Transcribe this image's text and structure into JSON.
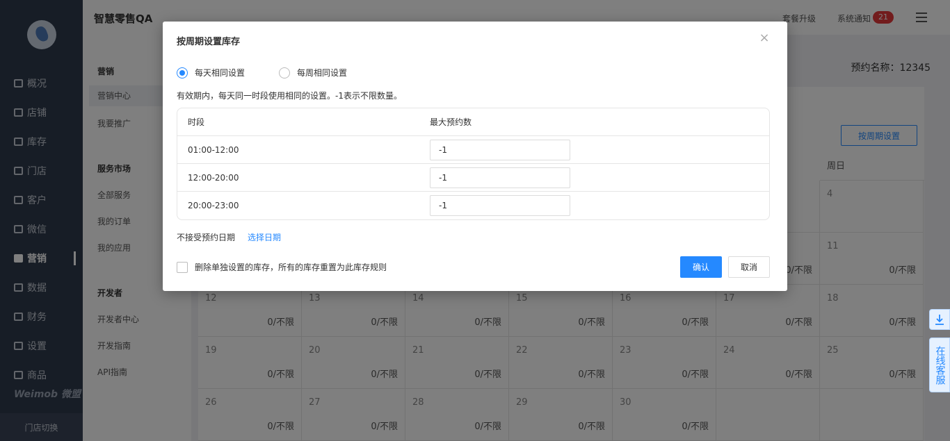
{
  "app": {
    "title": "智慧零售QA",
    "package_upgrade": "套餐升级",
    "system_notice": "系统通知",
    "notice_count": "21",
    "brand": "Weimob 微盟",
    "store_switch": "门店切换"
  },
  "sidebar": {
    "items": [
      {
        "label": "概况",
        "icon": "overview-icon"
      },
      {
        "label": "店铺",
        "icon": "shop-icon"
      },
      {
        "label": "库存",
        "icon": "inventory-icon"
      },
      {
        "label": "门店",
        "icon": "store-icon"
      },
      {
        "label": "客户",
        "icon": "customer-icon"
      },
      {
        "label": "微信",
        "icon": "wechat-icon"
      },
      {
        "label": "营销",
        "icon": "marketing-icon",
        "active": true
      },
      {
        "label": "数据",
        "icon": "data-icon"
      },
      {
        "label": "财务",
        "icon": "finance-icon"
      },
      {
        "label": "设置",
        "icon": "settings-icon"
      },
      {
        "label": "商品",
        "icon": "goods-icon"
      }
    ]
  },
  "subnav": {
    "group1": "营销",
    "marketing_center": "营销中心",
    "promote": "我要推广",
    "group2": "服务市场",
    "all_services": "全部服务",
    "my_orders": "我的订单",
    "my_apps": "我的应用",
    "group3": "开发者",
    "dev_center": "开发者中心",
    "dev_guide": "开发指南",
    "api_guide": "API指南"
  },
  "content": {
    "booking_name": "预约名称：12345",
    "set_weekly_button": "按周期设置",
    "calendar": {
      "sunday_header": "周日",
      "rows": [
        [
          {
            "day": "",
            "stock": ""
          },
          {
            "day": "",
            "stock": ""
          },
          {
            "day": "",
            "stock": ""
          },
          {
            "day": "",
            "stock": ""
          },
          {
            "day": "",
            "stock": ""
          },
          {
            "day": "",
            "stock": ""
          },
          {
            "day": "4",
            "stock": ""
          }
        ],
        [
          {
            "day": "",
            "stock": ""
          },
          {
            "day": "",
            "stock": ""
          },
          {
            "day": "",
            "stock": ""
          },
          {
            "day": "",
            "stock": ""
          },
          {
            "day": "",
            "stock": ""
          },
          {
            "day": "",
            "stock": "0/不限"
          },
          {
            "day": "11",
            "stock": "0/不限"
          }
        ],
        [
          {
            "day": "12",
            "stock": "0/不限"
          },
          {
            "day": "13",
            "stock": "0/不限"
          },
          {
            "day": "14",
            "stock": "0/不限"
          },
          {
            "day": "15",
            "stock": "0/不限"
          },
          {
            "day": "16",
            "stock": "0/不限"
          },
          {
            "day": "17",
            "stock": "0/不限"
          },
          {
            "day": "18",
            "stock": "0/不限"
          }
        ],
        [
          {
            "day": "19",
            "stock": "0/不限"
          },
          {
            "day": "20",
            "stock": "0/不限"
          },
          {
            "day": "21",
            "stock": "0/不限"
          },
          {
            "day": "22",
            "stock": "0/不限"
          },
          {
            "day": "23",
            "stock": "0/不限"
          },
          {
            "day": "24",
            "stock": "0/不限"
          },
          {
            "day": "25",
            "stock": "0/不限"
          }
        ],
        [
          {
            "day": "26",
            "stock": "0/不限"
          },
          {
            "day": "27",
            "stock": "0/不限"
          },
          {
            "day": "28",
            "stock": "0/不限"
          },
          {
            "day": "29",
            "stock": "0/不限"
          },
          {
            "day": "30",
            "stock": "0/不限"
          },
          {
            "day": "",
            "stock": ""
          },
          {
            "day": "",
            "stock": ""
          }
        ]
      ]
    }
  },
  "float": {
    "online_service": "在线客服"
  },
  "modal": {
    "title": "按周期设置库存",
    "close": "×",
    "radio_daily": "每天相同设置",
    "radio_weekly": "每周相同设置",
    "selected": "daily",
    "hint": "有效期内，每天同一时段使用相同的设置。-1表示不限数量。",
    "table": {
      "col_period": "时段",
      "col_max": "最大预约数",
      "rows": [
        {
          "period": "01:00-12:00",
          "max": "-1"
        },
        {
          "period": "12:00-20:00",
          "max": "-1"
        },
        {
          "period": "20:00-23:00",
          "max": "-1"
        }
      ]
    },
    "no_booking_label": "不接受预约日期",
    "choose_date": "选择日期",
    "delete_checkbox": "删除单独设置的库存，所有的库存重置为此库存规则",
    "confirm": "确认",
    "cancel": "取消"
  },
  "colors": {
    "accent": "#2589ff",
    "sidebar": "#2f3a4c",
    "badge": "#e5383b"
  }
}
